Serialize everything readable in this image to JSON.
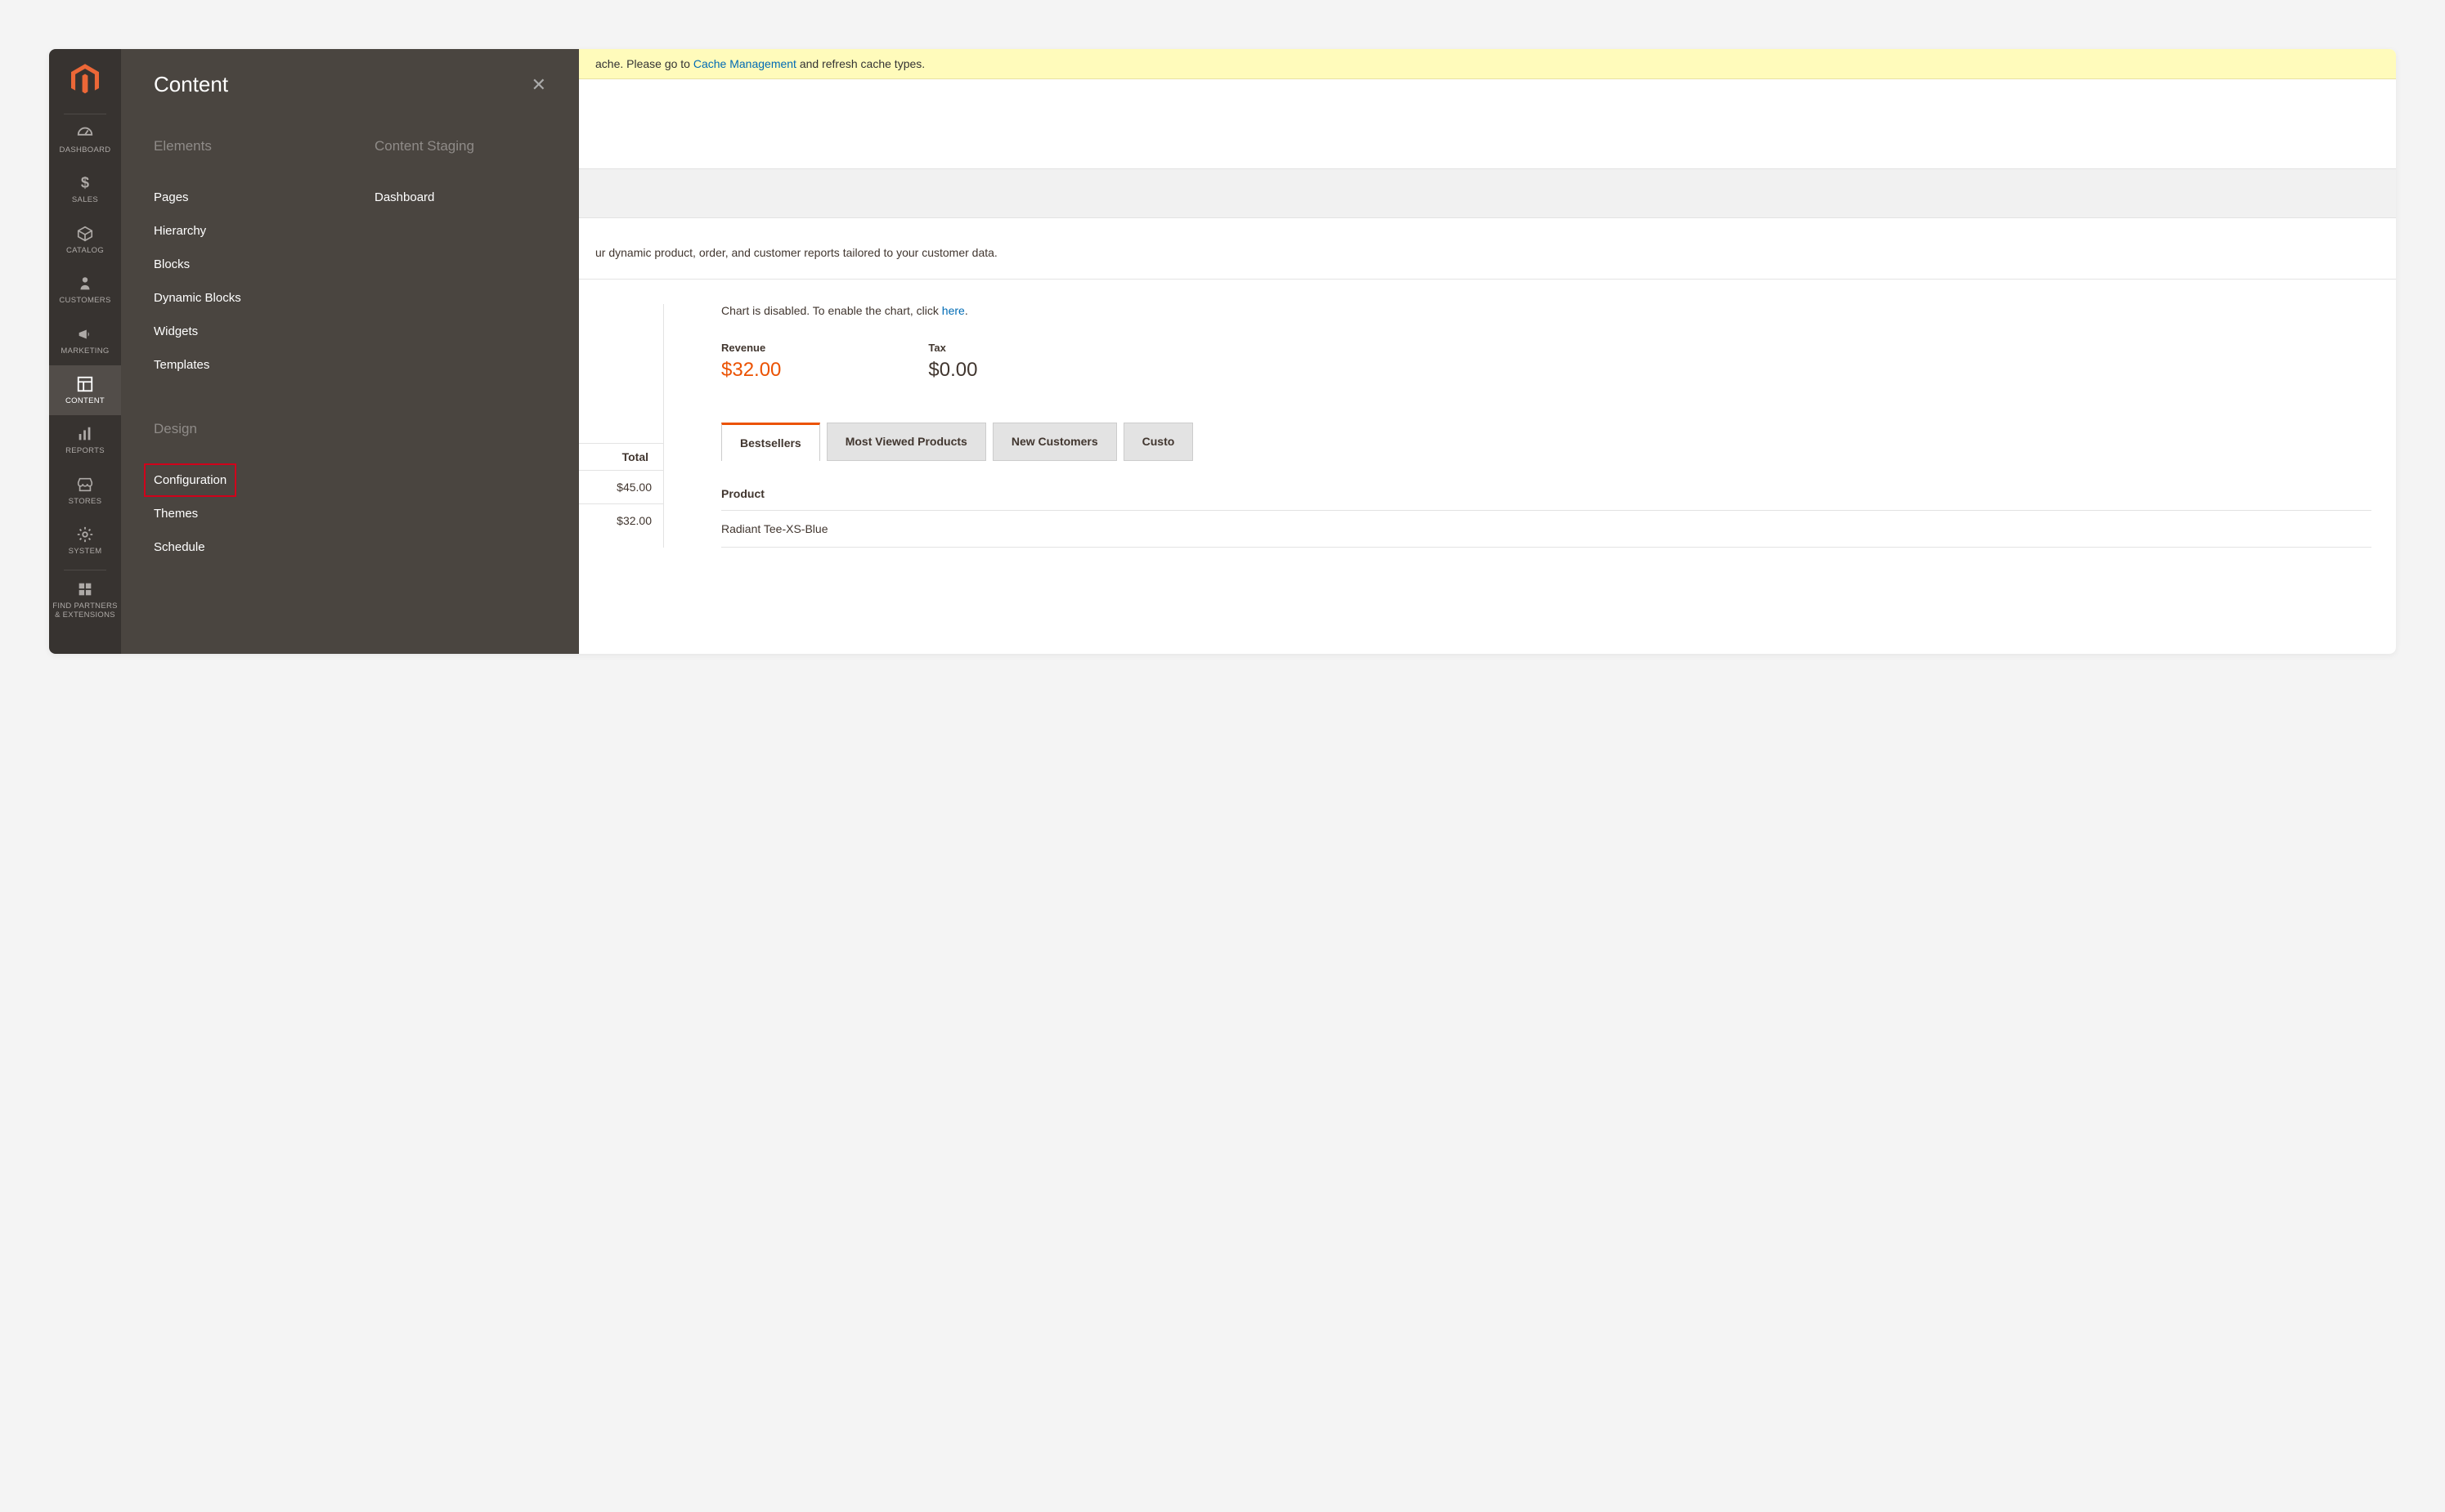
{
  "sidebar": {
    "items": [
      {
        "label": "DASHBOARD",
        "icon": "dashboard"
      },
      {
        "label": "SALES",
        "icon": "dollar"
      },
      {
        "label": "CATALOG",
        "icon": "box"
      },
      {
        "label": "CUSTOMERS",
        "icon": "person"
      },
      {
        "label": "MARKETING",
        "icon": "megaphone"
      },
      {
        "label": "CONTENT",
        "icon": "layout",
        "active": true
      },
      {
        "label": "REPORTS",
        "icon": "bars"
      },
      {
        "label": "STORES",
        "icon": "store"
      },
      {
        "label": "SYSTEM",
        "icon": "gear"
      },
      {
        "label": "FIND PARTNERS & EXTENSIONS",
        "icon": "blocks"
      }
    ]
  },
  "flyout": {
    "title": "Content",
    "sections": [
      {
        "header": "Elements",
        "links": [
          "Pages",
          "Hierarchy",
          "Blocks",
          "Dynamic Blocks",
          "Widgets",
          "Templates"
        ]
      },
      {
        "header": "Design",
        "links": [
          "Configuration",
          "Themes",
          "Schedule"
        ],
        "highlight": "Configuration"
      }
    ],
    "right": {
      "header": "Content Staging",
      "links": [
        "Dashboard"
      ]
    }
  },
  "banner": {
    "prefix": "ache. Please go to ",
    "link": "Cache Management",
    "suffix": " and refresh cache types."
  },
  "reportsMsg": "ur dynamic product, order, and customer reports tailored to your customer data.",
  "chartMsg": {
    "pre": "Chart is disabled. To enable the chart, click ",
    "link": "here",
    "post": "."
  },
  "metrics": [
    {
      "label": "Revenue",
      "value": "$32.00",
      "orange": true
    },
    {
      "label": "Tax",
      "value": "$0.00",
      "orange": false
    }
  ],
  "tabs": [
    "Bestsellers",
    "Most Viewed Products",
    "New Customers",
    "Custo"
  ],
  "totalsHeader": "Total",
  "totals": [
    "$45.00",
    "$32.00"
  ],
  "tableHeader": "Product",
  "tableRows": [
    "Radiant Tee-XS-Blue"
  ]
}
